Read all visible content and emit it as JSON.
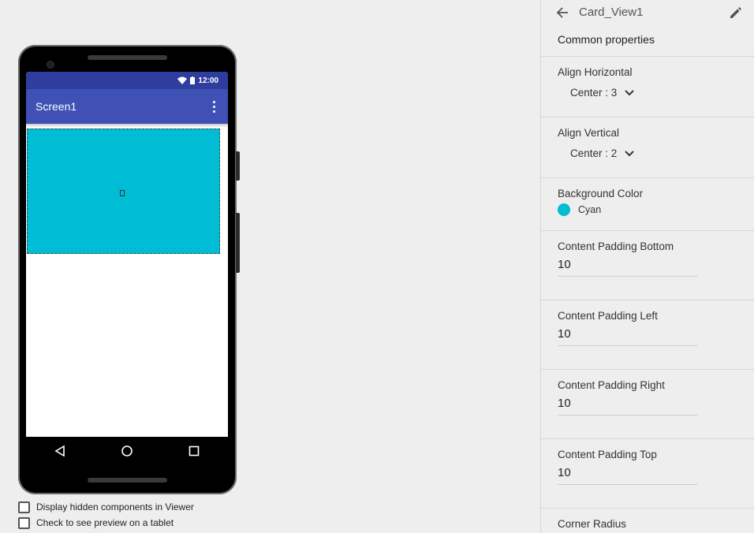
{
  "phone": {
    "status_time": "12:00",
    "screen_title": "Screen1",
    "card_color": "#00bcd4",
    "appbar_color": "#3f51b5",
    "statusbar_color": "#2f3e9e",
    "nav_icons": [
      "back-triangle-icon",
      "home-circle-icon",
      "recents-square-icon"
    ]
  },
  "viewer_options": {
    "hidden_components": "Display hidden components in Viewer",
    "tablet_preview": "Check to see preview on a tablet"
  },
  "properties": {
    "component_name": "Card_View1",
    "section_title": "Common properties",
    "align_horizontal": {
      "label": "Align Horizontal",
      "value": "Center : 3"
    },
    "align_vertical": {
      "label": "Align Vertical",
      "value": "Center : 2"
    },
    "background_color": {
      "label": "Background Color",
      "value": "Cyan",
      "swatch": "#00bcd4"
    },
    "padding_bottom": {
      "label": "Content Padding Bottom",
      "value": "10"
    },
    "padding_left": {
      "label": "Content Padding Left",
      "value": "10"
    },
    "padding_right": {
      "label": "Content Padding Right",
      "value": "10"
    },
    "padding_top": {
      "label": "Content Padding Top",
      "value": "10"
    },
    "corner_radius": {
      "label": "Corner Radius"
    }
  }
}
